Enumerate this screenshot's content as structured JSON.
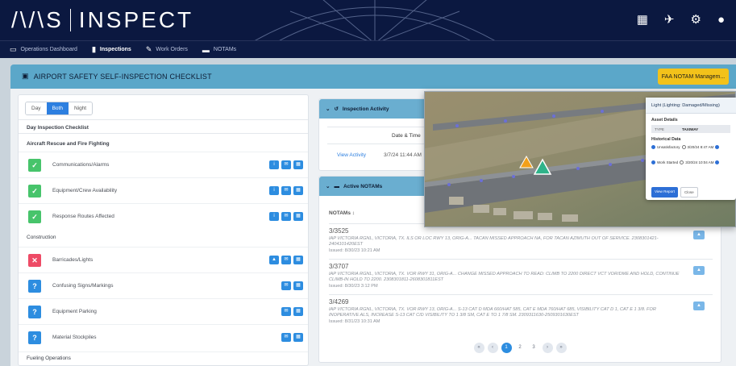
{
  "app": {
    "logo_left": "/\\/\\S",
    "logo_right": "INSPECT"
  },
  "top_icons": [
    "grid-icon",
    "plane-icon",
    "gear-icon",
    "user-icon"
  ],
  "nav": [
    {
      "label": "Operations Dashboard",
      "icon": "dashboard-icon"
    },
    {
      "label": "Inspections",
      "icon": "clipboard-icon",
      "active": true
    },
    {
      "label": "Work Orders",
      "icon": "wrench-icon"
    },
    {
      "label": "NOTAMs",
      "icon": "chat-icon"
    }
  ],
  "header": {
    "title": "AIRPORT SAFETY SELF-INSPECTION CHECKLIST",
    "faa_button": "FAA NOTAM Managem..."
  },
  "checklist": {
    "toggle": [
      "Day",
      "Both",
      "Night"
    ],
    "toggle_selected": "Both",
    "list_title": "Day Inspection Checklist",
    "sections": [
      {
        "title": "Aircraft Rescue and Fire Fighting",
        "items": [
          {
            "label": "Communications/Alarms",
            "status": "ok"
          },
          {
            "label": "Equipment/Crew Availability",
            "status": "ok"
          },
          {
            "label": "Response Routes Affected",
            "status": "ok"
          }
        ]
      },
      {
        "title": "Construction",
        "items": [
          {
            "label": "Barricades/Lights",
            "status": "bad"
          },
          {
            "label": "Confusing Signs/Markings",
            "status": "unknown"
          },
          {
            "label": "Equipment Parking",
            "status": "unknown"
          },
          {
            "label": "Material Stockpiles",
            "status": "unknown"
          }
        ]
      },
      {
        "title": "Fueling Operations",
        "items": []
      }
    ]
  },
  "activity": {
    "title": "Inspection Activity",
    "col_date": "Date & Time",
    "link": "View Activity",
    "date": "3/7/24 11:44 AM"
  },
  "notams": {
    "title": "Active NOTAMs",
    "col": "NOTAMs",
    "items": [
      {
        "id": "3/3525",
        "text": "IAP VICTORIA RGNL, VICTORIA, TX. ILS OR LOC RWY 13, ORIG-A... TACAN MISSED APPROACH NA, FOR TACAN AZIMUTH OUT OF SERVICE. 2308301421-2404101420EST",
        "issued": "Issued: 8/30/23 10:21 AM"
      },
      {
        "id": "3/3707",
        "text": "IAP VICTORIA RGNL, VICTORIA, TX. VOR RWY 31, ORIG-A... CHANGE MISSED APPROACH TO READ: CLIMB TO 2200 DIRECT VCT VOR/DME AND HOLD, CONTINUE CLIMB-IN HOLD TO 2200. 2308301811-2608301811EST",
        "issued": "Issued: 8/30/23 3:12 PM"
      },
      {
        "id": "3/4269",
        "text": "IAP VICTORIA RGNL, VICTORIA, TX. VOR RWY 13, ORIG-A... S-13 CAT D MDA 660/HAT 585, CAT E MDA 760/HAT 685, VISIBILITY CAT D 1, CAT E 1 3/8. FOR INOPERATIVE ALS, INCREASE S-13 CAT C/D VISIBILITY TO 1 3/8 SM, CAT E TO 1 7/8 SM. 2309311630-2509301630EST",
        "issued": "Issued: 8/31/23 10:31 AM"
      }
    ],
    "pager": [
      "«",
      "‹",
      "1",
      "2",
      "3",
      "›",
      "»"
    ],
    "pager_current": "1"
  },
  "popup": {
    "title": "Light (Lighting: Damaged/Missing)",
    "asset_label": "Asset Details",
    "type_key": "TYPE",
    "type_value": "TAXIWAY",
    "hist_label": "Historical Data",
    "hist": [
      {
        "status": "Unsatisfactory",
        "time": "3/20/24 8:47 AM"
      },
      {
        "status": "Work Started",
        "time": "3/20/24 10:04 AM"
      }
    ],
    "view_btn": "View Report",
    "close_btn": "Close"
  },
  "colors": {
    "topbar": "#0b1840",
    "header": "#5ba7c9",
    "accent": "#2d8de0",
    "ok": "#47c46b",
    "bad": "#ee4b66",
    "faa": "#f3c21a"
  }
}
